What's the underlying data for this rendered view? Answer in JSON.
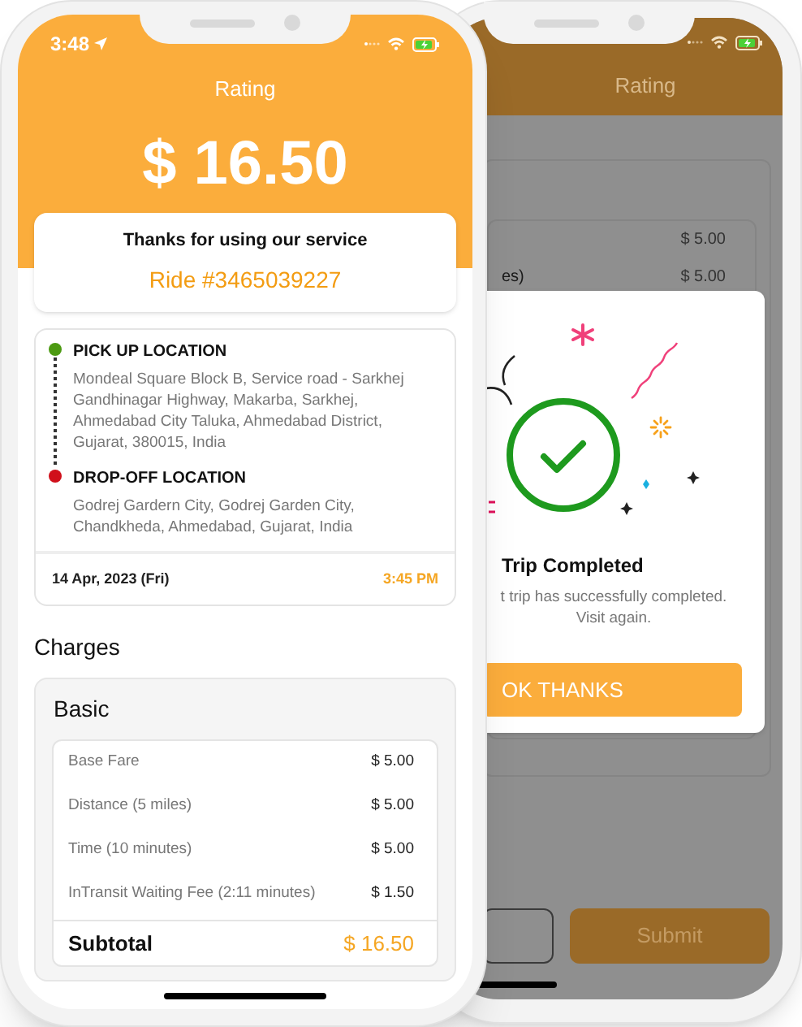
{
  "front_phone": {
    "status_bar": {
      "time": "3:48"
    },
    "header": {
      "title": "Rating",
      "amount": "$ 16.50"
    },
    "thanks_card": {
      "message": "Thanks for using our service",
      "ride": "Ride #3465039227"
    },
    "trip": {
      "stops": [
        {
          "label": "PICK UP LOCATION",
          "address": "Mondeal Square Block B, Service road - Sarkhej Gandhinagar Highway, Makarba, Sarkhej, Ahmedabad City Taluka, Ahmedabad District, Gujarat, 380015, India",
          "color": "#4c9a12"
        },
        {
          "label": "DROP-OFF LOCATION",
          "address": "Godrej Gardern City, Godrej Garden City, Chandkheda, Ahmedabad, Gujarat, India",
          "color": "#d0101b"
        }
      ],
      "date": "14 Apr, 2023 (Fri)",
      "time": "3:45 PM"
    },
    "charges": {
      "title": "Charges",
      "group": {
        "title": "Basic",
        "items": [
          {
            "label": "Base Fare",
            "amount": "$ 5.00"
          },
          {
            "label": "Distance (5 miles)",
            "amount": "$ 5.00"
          },
          {
            "label": "Time (10 minutes)",
            "amount": "$ 5.00"
          },
          {
            "label": "InTransit Waiting Fee (2:11 minutes)",
            "amount": "$ 1.50"
          }
        ],
        "subtotal": {
          "label": "Subtotal",
          "amount": "$ 16.50"
        }
      }
    }
  },
  "back_phone": {
    "header": {
      "title": "Rating"
    },
    "background_rows": [
      {
        "amount": "$ 5.00"
      },
      {
        "label": "es)",
        "amount": "$ 5.00"
      }
    ],
    "dialog": {
      "title": "Trip Completed",
      "message_lines": [
        "t trip has successfully completed.",
        "Visit again."
      ],
      "button": "OK THANKS"
    },
    "submit_button": "Submit"
  }
}
